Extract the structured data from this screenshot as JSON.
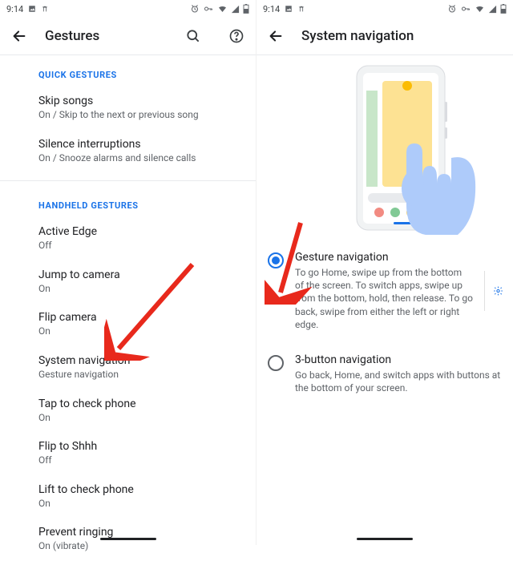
{
  "status": {
    "time": "9:14"
  },
  "left": {
    "title": "Gestures",
    "sections": [
      {
        "header": "QUICK GESTURES",
        "items": [
          {
            "title": "Skip songs",
            "subtitle": "On / Skip to the next or previous song"
          },
          {
            "title": "Silence interruptions",
            "subtitle": "On / Snooze alarms and silence calls"
          }
        ]
      },
      {
        "header": "HANDHELD GESTURES",
        "items": [
          {
            "title": "Active Edge",
            "subtitle": "Off"
          },
          {
            "title": "Jump to camera",
            "subtitle": "On"
          },
          {
            "title": "Flip camera",
            "subtitle": "On"
          },
          {
            "title": "System navigation",
            "subtitle": "Gesture navigation"
          },
          {
            "title": "Tap to check phone",
            "subtitle": "On"
          },
          {
            "title": "Flip to Shhh",
            "subtitle": "Off"
          },
          {
            "title": "Lift to check phone",
            "subtitle": "On"
          },
          {
            "title": "Prevent ringing",
            "subtitle": "On (vibrate)"
          }
        ]
      }
    ]
  },
  "right": {
    "title": "System navigation",
    "options": [
      {
        "title": "Gesture navigation",
        "subtitle": "To go Home, swipe up from the bottom of the screen. To switch apps, swipe up from the bottom, hold, then release. To go back, swipe from either the left or right edge.",
        "selected": true,
        "settings_gear": true
      },
      {
        "title": "3-button navigation",
        "subtitle": "Go back, Home, and switch apps with buttons at the bottom of your screen.",
        "selected": false,
        "settings_gear": false
      }
    ]
  }
}
